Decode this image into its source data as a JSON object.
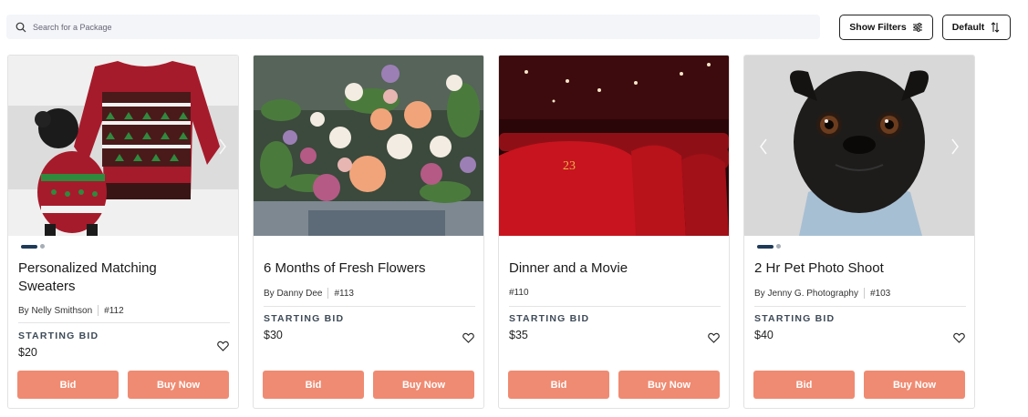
{
  "search": {
    "placeholder": "Search for a Package",
    "icon": "search-icon"
  },
  "header": {
    "filters_label": "Show Filters",
    "filters_icon": "sliders-icon",
    "sort_label": "Default",
    "sort_icon": "sort-arrows-icon"
  },
  "colors": {
    "accent": "#ef8b72",
    "dot_active": "#1f3a56"
  },
  "cards": [
    {
      "title_line1": "Personalized Matching",
      "title_line2": "Sweaters",
      "by": "By Nelly Smithson",
      "id": "#112",
      "bid_label": "STARTING BID",
      "price": "$20",
      "bid_button": "Bid",
      "buy_button": "Buy Now",
      "image": "christmas-sweater-dog-image"
    },
    {
      "title_line1": "6 Months of Fresh Flowers",
      "by": "By Danny Dee",
      "id": "#113",
      "bid_label": "STARTING BID",
      "price": "$30",
      "bid_button": "Bid",
      "buy_button": "Buy Now",
      "image": "flowers-bouquet-image"
    },
    {
      "title_line1": "Dinner and a Movie",
      "id": "#110",
      "bid_label": "STARTING BID",
      "price": "$35",
      "bid_button": "Bid",
      "buy_button": "Buy Now",
      "image": "cinema-seats-image"
    },
    {
      "title_line1": "2 Hr Pet Photo Shoot",
      "by": "By Jenny G. Photography",
      "id": "#103",
      "bid_label": "STARTING BID",
      "price": "$40",
      "bid_button": "Bid",
      "buy_button": "Buy Now",
      "image": "pug-photo-image"
    }
  ]
}
